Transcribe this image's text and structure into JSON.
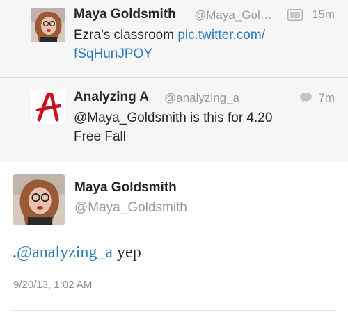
{
  "timeline": [
    {
      "author_name": "Maya Goldsmith",
      "author_handle": "@Maya_Gol…",
      "time": "15m",
      "text_line1": "Ezra's classroom ",
      "link_part1": "pic.twitter.com/",
      "link_part2": "fSqHunJPOY",
      "meta_icon": "media-icon"
    },
    {
      "author_name": "Analyzing A",
      "author_handle": "@analyzing_a",
      "time": "7m",
      "text_line1": "@Maya_Goldsmith is this for 4.20",
      "text_line2": "Free Fall",
      "meta_icon": "conversation-icon",
      "avatar_letter": "A"
    }
  ],
  "detail": {
    "author_name": "Maya Goldsmith",
    "author_handle": "@Maya_Goldsmith",
    "text_prefix": ".",
    "mention": "@analyzing_a",
    "text_suffix": " yep",
    "date": "9/20/13, 1:02 AM"
  },
  "colors": {
    "link": "#2b7bb9",
    "muted": "#9a9a9a",
    "row_background": "#f6f6f6",
    "avatar_logo_red": "#c8141e"
  }
}
